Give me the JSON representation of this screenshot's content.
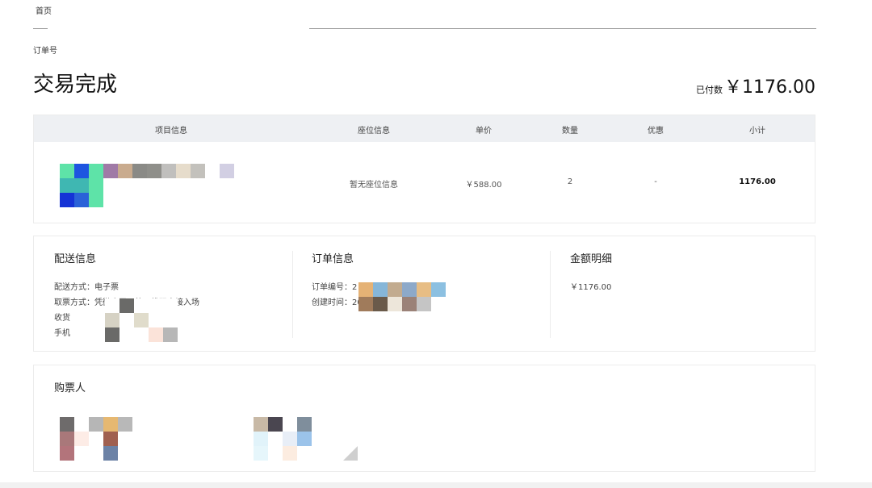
{
  "breadcrumb": {
    "home": "首页"
  },
  "order": {
    "number_label": "订单号",
    "status_title": "交易完成",
    "paid_label": "已付数",
    "paid_amount": "￥1176.00"
  },
  "items_table": {
    "headers": [
      "项目信息",
      "座位信息",
      "单价",
      "数量",
      "优惠",
      "小计"
    ],
    "row": {
      "seat": "暂无座位信息",
      "unit_price": "￥588.00",
      "quantity": "2",
      "discount": "-",
      "subtotal": "1176.00"
    }
  },
  "delivery": {
    "title": "配送信息",
    "method": "配送方式：电子票",
    "pickup": "取票方式：凭微店展示的二维码直接入场",
    "receiver": "收货",
    "phone": "手机"
  },
  "order_info": {
    "title": "订单信息",
    "order_id": "订单编号：2",
    "created": "创建时间：20"
  },
  "amount_detail": {
    "title": "金额明细",
    "amount": "￥1176.00"
  },
  "buyer": {
    "title": "购票人"
  },
  "colors": {
    "header_bg": "#eef0f3",
    "border": "#ececec",
    "text_dark": "#111111"
  }
}
